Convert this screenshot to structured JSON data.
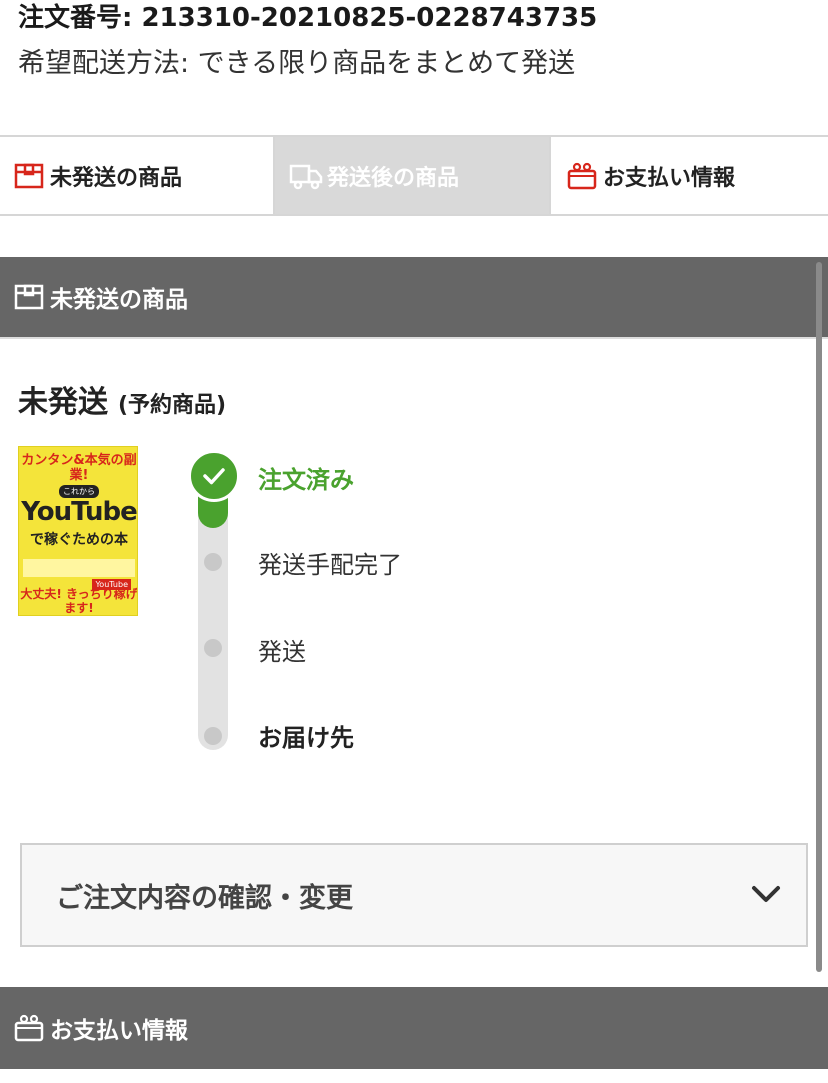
{
  "order": {
    "number_label": "注文番号: 213310-20210825-0228743735",
    "delivery_label": "希望配送方法: できる限り商品をまとめて発送"
  },
  "tabs": [
    {
      "label": "未発送の商品",
      "icon": "box-icon",
      "active": false
    },
    {
      "label": "発送後の商品",
      "icon": "truck-icon",
      "active": true
    },
    {
      "label": "お支払い情報",
      "icon": "wallet-icon",
      "active": false
    }
  ],
  "sections": {
    "unshipped_title": "未発送の商品",
    "payment_title": "お支払い情報"
  },
  "status": {
    "title": "未発送",
    "subtitle": "(予約商品)"
  },
  "product": {
    "cover_top": "カンタン&本気の副業!",
    "cover_kore": "これから",
    "cover_main": "YouTube",
    "cover_sub": "で稼ぐための本",
    "cover_bottom": "大丈夫! きっちり稼げます!",
    "cover_tag": "YouTube"
  },
  "timeline": {
    "steps": [
      {
        "label": "注文済み",
        "done": true
      },
      {
        "label": "発送手配完了",
        "done": false
      },
      {
        "label": "発送",
        "done": false
      },
      {
        "label": "お届け先",
        "done": false
      }
    ]
  },
  "accordion": {
    "label": "ご注文内容の確認・変更"
  },
  "colors": {
    "accent_green": "#4aa22e",
    "brand_red": "#d7261b",
    "section_bar": "#666666"
  }
}
